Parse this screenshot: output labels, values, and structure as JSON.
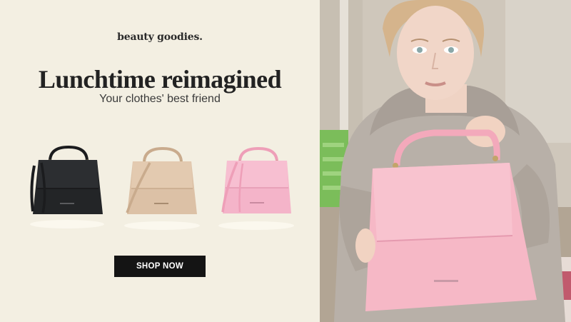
{
  "brand": {
    "name": "beauty goodies."
  },
  "hero": {
    "headline": "Lunchtime reimagined",
    "subheadline": "Your clothes' best friend"
  },
  "products": [
    {
      "name": "black-handbag",
      "color": "#232527"
    },
    {
      "name": "beige-handbag",
      "color": "#dcc1a6"
    },
    {
      "name": "pink-handbag",
      "color": "#f4b4c9"
    }
  ],
  "cta": {
    "label": "SHOP NOW"
  },
  "photo": {
    "subject": "woman-holding-pink-handbag",
    "bag_color": "#f6b8c6"
  }
}
